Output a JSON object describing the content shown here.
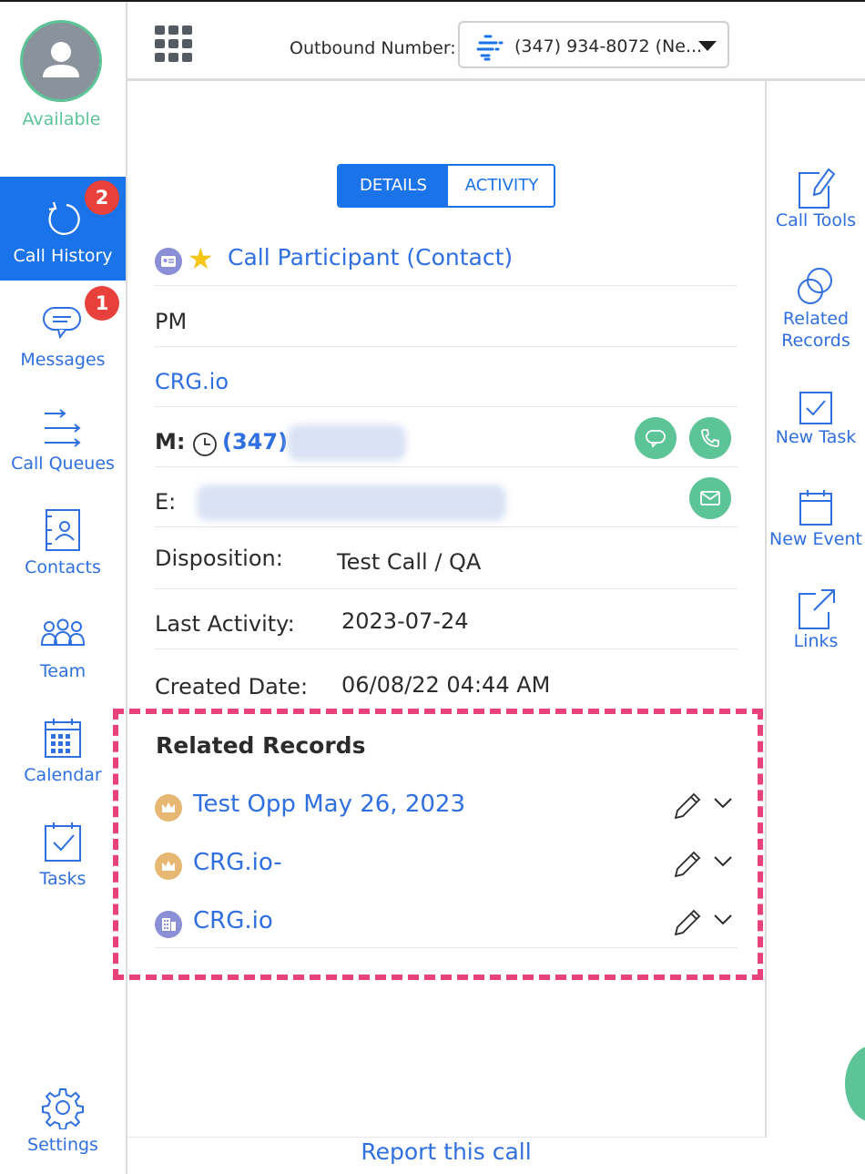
{
  "user": {
    "status": "Available",
    "status_color": "#5cc497"
  },
  "sidebar": {
    "items": [
      {
        "label": "Call History",
        "icon": "refresh-icon",
        "badge": "2",
        "active": true
      },
      {
        "label": "Messages",
        "icon": "chat-bubble-icon",
        "badge": "1"
      },
      {
        "label": "Call Queues",
        "icon": "arrows-queue-icon"
      },
      {
        "label": "Contacts",
        "icon": "contact-card-icon"
      },
      {
        "label": "Team",
        "icon": "team-icon"
      },
      {
        "label": "Calendar",
        "icon": "calendar-icon"
      },
      {
        "label": "Tasks",
        "icon": "tasks-icon"
      },
      {
        "label": "Settings",
        "icon": "gear-icon"
      }
    ]
  },
  "topbar": {
    "outbound_label": "Outbound Number:",
    "outbound_value": "(347) 934-8072 (Ne..."
  },
  "tabs": [
    {
      "label": "DETAILS",
      "active": true
    },
    {
      "label": "ACTIVITY",
      "active": false
    }
  ],
  "participant": {
    "title": "Call Participant (Contact)",
    "role": "PM",
    "company": "CRG.io",
    "mobile_label": "M:",
    "mobile_value": "(347)",
    "email_label": "E:"
  },
  "fields": [
    {
      "label": "Disposition:",
      "value": "Test Call / QA"
    },
    {
      "label": "Last Activity:",
      "value": "2023-07-24"
    },
    {
      "label": "Created Date:",
      "value": "06/08/22 04:44 AM"
    }
  ],
  "related_records": {
    "title": "Related Records",
    "items": [
      {
        "label": "Test Opp May 26, 2023",
        "icon": "crown-icon",
        "icon_color": "#e7b873"
      },
      {
        "label": "CRG.io-",
        "icon": "crown-icon",
        "icon_color": "#e7b873"
      },
      {
        "label": "CRG.io",
        "icon": "building-icon",
        "icon_color": "#8b8fd6"
      }
    ]
  },
  "right_rail": [
    {
      "label": "Call Tools",
      "icon": "edit-icon"
    },
    {
      "label_lines": [
        "Related",
        "Records"
      ],
      "icon": "linked-circles-icon"
    },
    {
      "label": "New Task",
      "icon": "checkbox-icon"
    },
    {
      "label": "New Event",
      "icon": "calendar-icon"
    },
    {
      "label": "Links",
      "icon": "external-link-icon"
    }
  ],
  "footer": {
    "report_label": "Report this call"
  },
  "colors": {
    "accent": "#1a73e8",
    "link": "#2f6fe0",
    "green": "#5cc497",
    "badge_red": "#e8413b",
    "highlight_pink": "#e8427a"
  }
}
